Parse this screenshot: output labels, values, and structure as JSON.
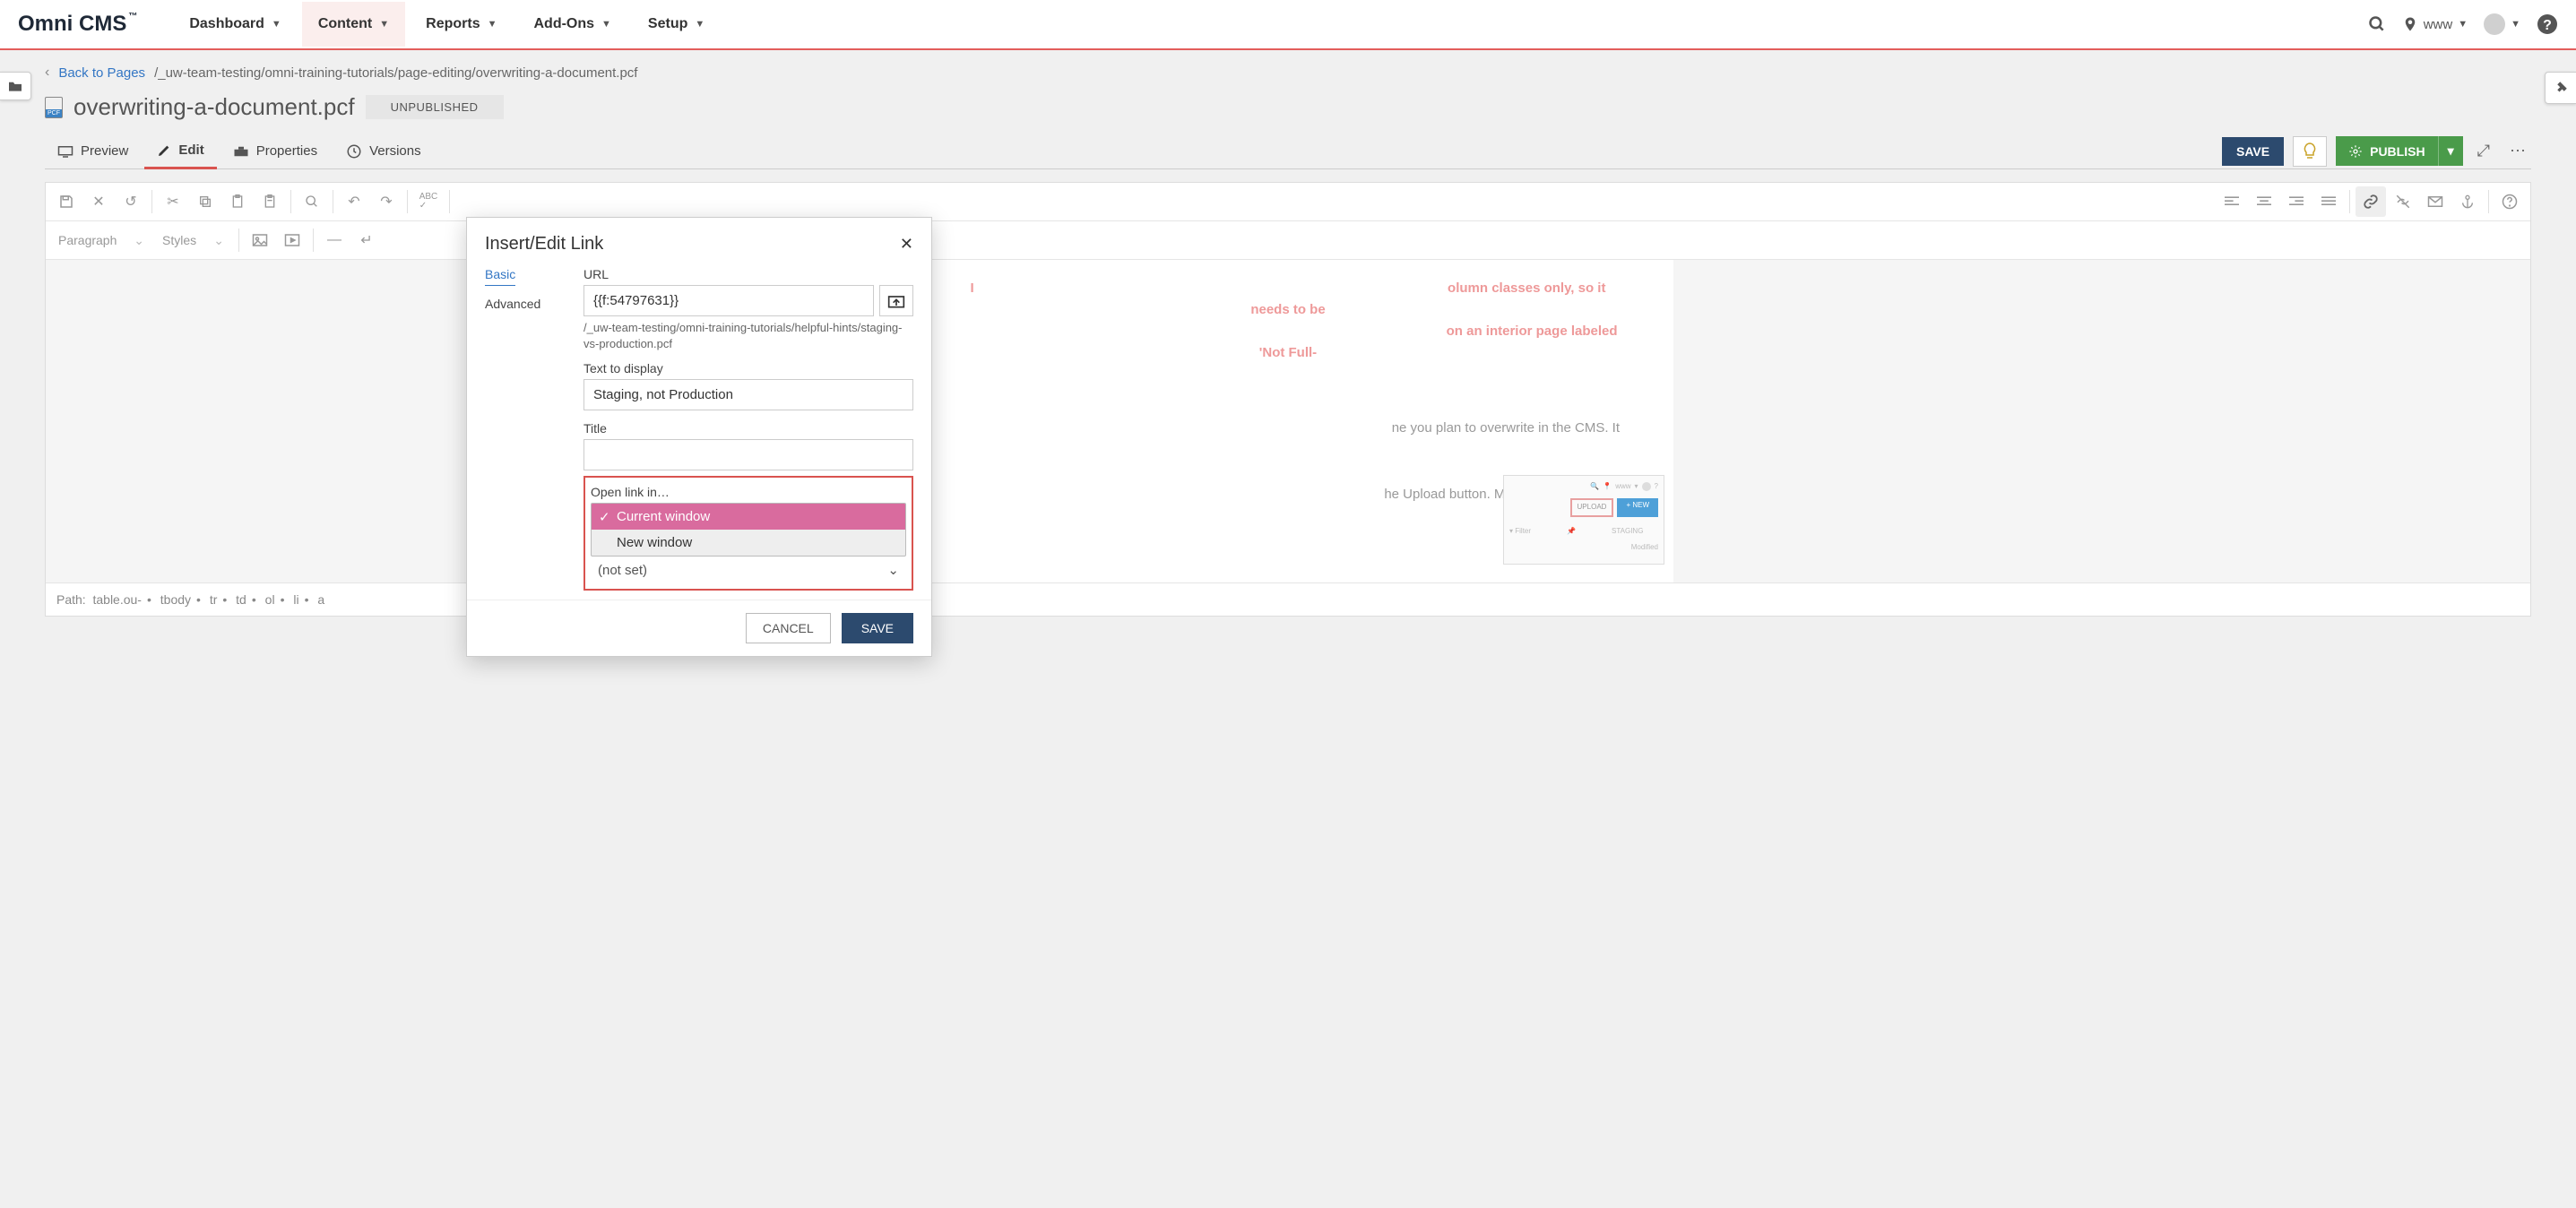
{
  "logo": "Omni CMS",
  "nav": {
    "dashboard": "Dashboard",
    "content": "Content",
    "reports": "Reports",
    "addons": "Add-Ons",
    "setup": "Setup"
  },
  "site_selector": "www",
  "crumb": {
    "back": "Back to Pages",
    "path": "/_uw-team-testing/omni-training-tutorials/page-editing/overwriting-a-document.pcf"
  },
  "page": {
    "filename": "overwriting-a-document.pcf",
    "status": "UNPUBLISHED"
  },
  "tabs": {
    "preview": "Preview",
    "edit": "Edit",
    "properties": "Properties",
    "versions": "Versions"
  },
  "actions": {
    "save": "SAVE",
    "publish": "PUBLISH"
  },
  "toolbar": {
    "paragraph": "Paragraph",
    "styles": "Styles"
  },
  "canvas": {
    "hint_left": "I",
    "hint_right_1": "olumn classes only, so it needs to be",
    "hint_right_2": "on an interior page labeled 'Not Full-",
    "body1": "ne you plan to overwrite in the CMS. It",
    "body2": "he Upload button. Make sure you are in",
    "thumb_site": "www",
    "thumb_upload": "UPLOAD",
    "thumb_new": "+ NEW",
    "thumb_filter": "Filter",
    "thumb_staging": "STAGING",
    "thumb_modified": "Modified"
  },
  "path_bar": {
    "label": "Path:",
    "seg0": "table.ou-",
    "seg1": "tbody",
    "seg2": "tr",
    "seg3": "td",
    "seg4": "ol",
    "seg5": "li",
    "seg6": "a"
  },
  "modal": {
    "title": "Insert/Edit Link",
    "tabs": {
      "basic": "Basic",
      "advanced": "Advanced"
    },
    "url_label": "URL",
    "url_value": "{{f:54797631}}",
    "url_hint": "/_uw-team-testing/omni-training-tutorials/helpful-hints/staging-vs-production.pcf",
    "text_label": "Text to display",
    "text_value": "Staging, not Production",
    "title_label": "Title",
    "title_value": "",
    "open_label": "Open link in…",
    "opt_current": "Current window",
    "opt_new": "New window",
    "notset": "(not set)",
    "cancel": "CANCEL",
    "save": "SAVE"
  }
}
